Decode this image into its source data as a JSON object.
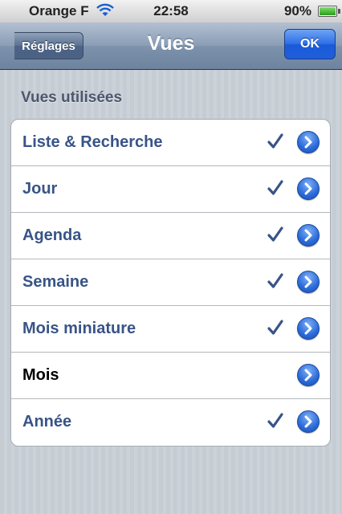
{
  "status_bar": {
    "carrier": "Orange F",
    "time": "22:58",
    "battery_percent": "90%",
    "battery_level": 0.9
  },
  "nav_bar": {
    "back_label": "Réglages",
    "title": "Vues",
    "ok_label": "OK"
  },
  "section": {
    "header": "Vues utilisées",
    "rows": [
      {
        "label": "Liste & Recherche",
        "checked": true
      },
      {
        "label": "Jour",
        "checked": true
      },
      {
        "label": "Agenda",
        "checked": true
      },
      {
        "label": "Semaine",
        "checked": true
      },
      {
        "label": "Mois miniature",
        "checked": true
      },
      {
        "label": "Mois",
        "checked": false
      },
      {
        "label": "Année",
        "checked": true
      }
    ]
  },
  "colors": {
    "selected_label": "#385487",
    "unselected_label": "#000000",
    "checkmark": "#385487",
    "accent": "#2a6ad8"
  },
  "icons": [
    "signal-icon",
    "wifi-icon",
    "battery-icon",
    "checkmark-icon",
    "disclosure-icon"
  ]
}
